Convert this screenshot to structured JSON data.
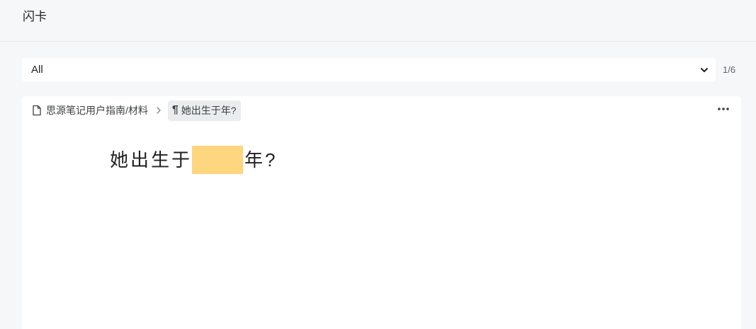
{
  "header": {
    "title": "闪卡"
  },
  "toolbar": {
    "deck_select_value": "All",
    "counter": "1/6"
  },
  "card": {
    "breadcrumb": {
      "document": "思源笔记用户指南/材料",
      "current_pilcrow": "¶",
      "current": "她出生于年?"
    },
    "question": {
      "before": "她出生于",
      "after": "年?"
    }
  },
  "icons": {
    "document": "document-icon",
    "separator": "chevron-right-icon",
    "more": "more-horizontal-icon",
    "select": "chevron-down-icon"
  },
  "colors": {
    "background": "#f6f7f9",
    "card": "#ffffff",
    "cloze_highlight": "#fdd67f",
    "current_crumb": "#ebecee"
  }
}
